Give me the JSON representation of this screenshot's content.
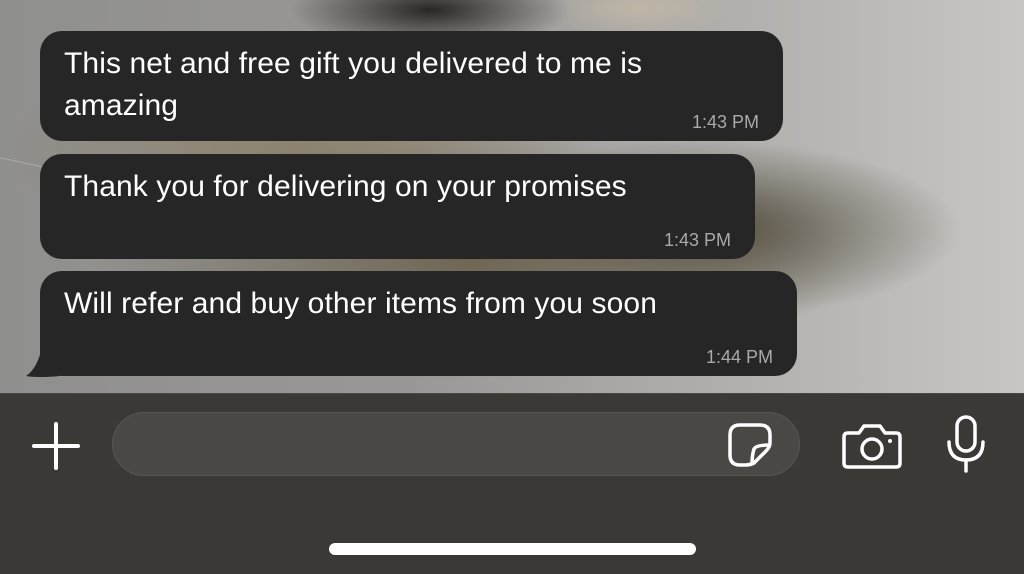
{
  "messages": [
    {
      "text": "This net and free gift you delivered to me is amazing",
      "time": "1:43 PM"
    },
    {
      "text": "Thank you for delivering on your promises",
      "time": "1:43 PM"
    },
    {
      "text": "Will refer and buy other items from you soon",
      "time": "1:44 PM"
    }
  ],
  "composer": {
    "input_value": "",
    "icons": {
      "add": "plus-icon",
      "sticker": "sticker-icon",
      "camera": "camera-icon",
      "mic": "microphone-icon"
    }
  },
  "colors": {
    "bubble": "#262626",
    "composer_bg": "#3b3935",
    "input_bg": "#4a4844",
    "text": "#ffffff",
    "timestamp": "#a9a9a9"
  }
}
